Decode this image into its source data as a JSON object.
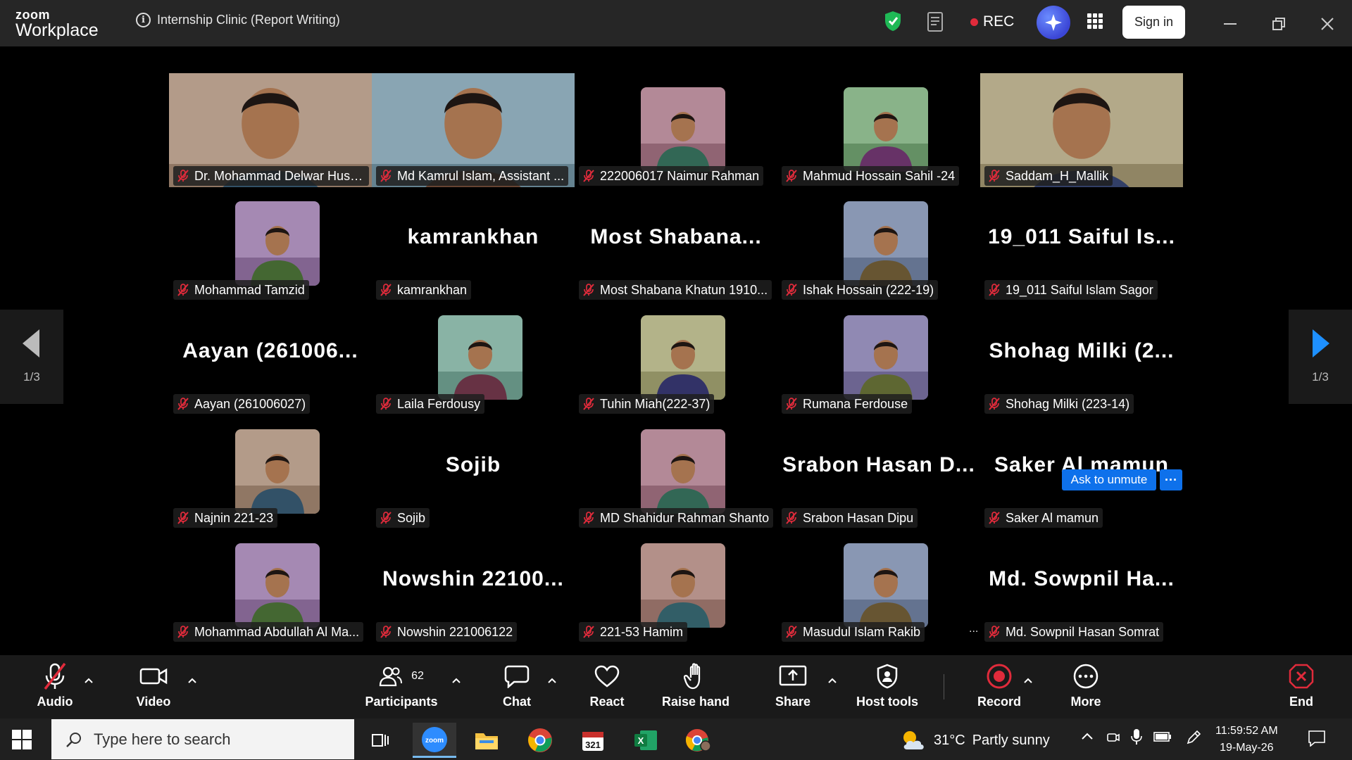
{
  "app": {
    "brand_top": "zoom",
    "brand_bottom": "Workplace",
    "meeting_title": "Internship Clinic (Report Writing)"
  },
  "header": {
    "rec_label": "REC",
    "signin_label": "Sign in"
  },
  "nav": {
    "page_left": "1/3",
    "page_right": "1/3"
  },
  "tiles": [
    {
      "label": "Dr. Mohammad Delwar Hussain",
      "big": "",
      "photo": true,
      "full": true,
      "speaker": true
    },
    {
      "label": "Md Kamrul Islam, Assistant ...",
      "big": "",
      "photo": true,
      "full": true
    },
    {
      "label": "222006017 Naimur Rahman",
      "big": "",
      "photo": true
    },
    {
      "label": "Mahmud Hossain Sahil -24",
      "big": "",
      "photo": true
    },
    {
      "label": "Saddam_H_Mallik",
      "big": "",
      "photo": true,
      "full": true
    },
    {
      "label": "Mohammad Tamzid",
      "big": "",
      "photo": true
    },
    {
      "label": "kamrankhan",
      "big": "kamrankhan"
    },
    {
      "label": "Most Shabana Khatun 1910...",
      "big": "Most  Shabana..."
    },
    {
      "label": "Ishak Hossain (222-19)",
      "big": "",
      "photo": true
    },
    {
      "label": "19_011 Saiful Islam Sagor",
      "big": "19_011  Saiful  Is..."
    },
    {
      "label": "Aayan (261006027)",
      "big": "Aayan  (261006..."
    },
    {
      "label": "Laila Ferdousy",
      "big": "",
      "photo": true
    },
    {
      "label": "Tuhin Miah(222-37)",
      "big": "",
      "photo": true
    },
    {
      "label": "Rumana Ferdouse",
      "big": "",
      "photo": true
    },
    {
      "label": "Shohag Milki (223-14)",
      "big": "Shohag  Milki  (2..."
    },
    {
      "label": "Najnin 221-23",
      "big": "",
      "photo": true
    },
    {
      "label": "Sojib",
      "big": "Sojib"
    },
    {
      "label": "MD Shahidur Rahman Shanto",
      "big": "",
      "photo": true
    },
    {
      "label": "Srabon Hasan Dipu",
      "big": "Srabon  Hasan  D..."
    },
    {
      "label": "Saker Al mamun",
      "big": "Saker  Al  mamun"
    },
    {
      "label": "Mohammad Abdullah Al Ma...",
      "big": "",
      "photo": true
    },
    {
      "label": "Nowshin 221006122",
      "big": "Nowshin  22100..."
    },
    {
      "label": "221-53 Hamim",
      "big": "",
      "photo": true
    },
    {
      "label": "Masudul Islam Rakib",
      "big": "",
      "photo": true
    },
    {
      "label": "Md. Sowpnil Hasan Somrat",
      "big": "Md.  Sowpnil  Ha..."
    }
  ],
  "ask_unmute": {
    "label": "Ask to unmute",
    "more": "···"
  },
  "extra_dots": "...",
  "toolbar": {
    "audio": "Audio",
    "video": "Video",
    "participants": "Participants",
    "participant_count": "62",
    "chat": "Chat",
    "react": "React",
    "raise_hand": "Raise hand",
    "share": "Share",
    "host_tools": "Host tools",
    "record": "Record",
    "more": "More",
    "end": "End"
  },
  "taskbar": {
    "search_placeholder": "Type here to search",
    "temperature": "31°C",
    "weather": "Partly sunny",
    "time": "11:59:52 AM",
    "date": "19-May-26"
  },
  "colors": {
    "accent": "#0e71eb",
    "speaker_border": "#23d160",
    "rec": "#e02b3b",
    "end": "#e02b3b"
  }
}
